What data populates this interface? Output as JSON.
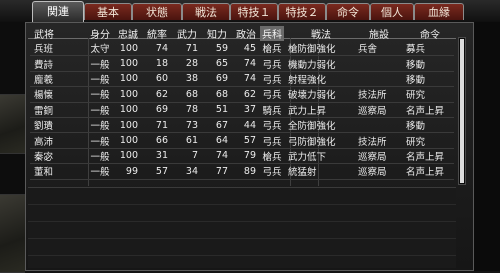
{
  "tabs": [
    "関連",
    "基本",
    "状態",
    "戦法",
    "特技１",
    "特技２",
    "命令",
    "個人",
    "血縁"
  ],
  "active_tab": "関連",
  "columns": [
    "武将",
    "身分",
    "忠誠",
    "統率",
    "武力",
    "知力",
    "政治",
    "兵科",
    "戦法",
    "施設",
    "命令"
  ],
  "sorted_column": "兵科",
  "rows": [
    {
      "name": "兵班",
      "status": "太守",
      "loyalty": "100",
      "lead": "74",
      "war": "71",
      "int": "59",
      "pol": "45",
      "unit": "槍兵",
      "tactic": "槍防御強化",
      "facility": "兵舎",
      "command": "募兵"
    },
    {
      "name": "費詩",
      "status": "一般",
      "loyalty": "100",
      "lead": "18",
      "war": "28",
      "int": "65",
      "pol": "74",
      "unit": "弓兵",
      "tactic": "機動力弱化",
      "facility": "",
      "command": "移動"
    },
    {
      "name": "龐羲",
      "status": "一般",
      "loyalty": "100",
      "lead": "60",
      "war": "38",
      "int": "69",
      "pol": "74",
      "unit": "弓兵",
      "tactic": "射程強化",
      "facility": "",
      "command": "移動"
    },
    {
      "name": "楊懐",
      "status": "一般",
      "loyalty": "100",
      "lead": "62",
      "war": "68",
      "int": "68",
      "pol": "62",
      "unit": "弓兵",
      "tactic": "破壊力弱化",
      "facility": "技法所",
      "command": "研究"
    },
    {
      "name": "雷銅",
      "status": "一般",
      "loyalty": "100",
      "lead": "69",
      "war": "78",
      "int": "51",
      "pol": "37",
      "unit": "騎兵",
      "tactic": "武力上昇",
      "facility": "巡察局",
      "command": "名声上昇"
    },
    {
      "name": "劉璝",
      "status": "一般",
      "loyalty": "100",
      "lead": "71",
      "war": "73",
      "int": "67",
      "pol": "44",
      "unit": "弓兵",
      "tactic": "全防御強化",
      "facility": "",
      "command": "移動"
    },
    {
      "name": "高沛",
      "status": "一般",
      "loyalty": "100",
      "lead": "66",
      "war": "61",
      "int": "64",
      "pol": "57",
      "unit": "弓兵",
      "tactic": "弓防御強化",
      "facility": "技法所",
      "command": "研究"
    },
    {
      "name": "秦宓",
      "status": "一般",
      "loyalty": "100",
      "lead": "31",
      "war": "7",
      "int": "74",
      "pol": "79",
      "unit": "槍兵",
      "tactic": "武力低下",
      "facility": "巡察局",
      "command": "名声上昇"
    },
    {
      "name": "董和",
      "status": "一般",
      "loyalty": "99",
      "lead": "57",
      "war": "34",
      "int": "77",
      "pol": "89",
      "unit": "弓兵",
      "tactic": "統猛射",
      "facility": "巡察局",
      "command": "名声上昇"
    }
  ]
}
